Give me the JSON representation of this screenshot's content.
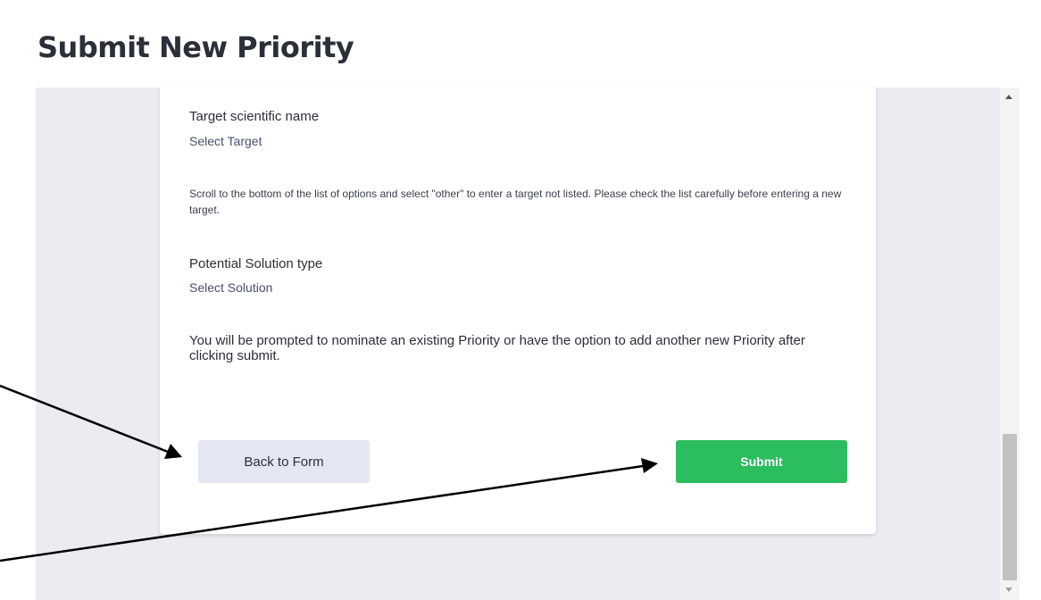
{
  "header": {
    "title": "Submit New Priority"
  },
  "form": {
    "target": {
      "label": "Target scientific name",
      "value": "Select Target",
      "help": "Scroll to the bottom of the list of options and select \"other\" to enter a target not listed. Please check the list carefully before entering a new target."
    },
    "solution": {
      "label": "Potential Solution type",
      "value": "Select Solution"
    },
    "prompt": "You will be prompted to nominate an existing Priority or have the option to add another new Priority after clicking submit.",
    "actions": {
      "back_label": "Back to Form",
      "submit_label": "Submit"
    }
  },
  "colors": {
    "submit_button": "#2bbd5e",
    "back_button": "#e4e6f1",
    "panel_background": "#ebecf1"
  },
  "icons": {
    "scroll_up": "chevron-up-icon",
    "scroll_down": "chevron-down-icon",
    "annotations": "arrow-icon"
  }
}
